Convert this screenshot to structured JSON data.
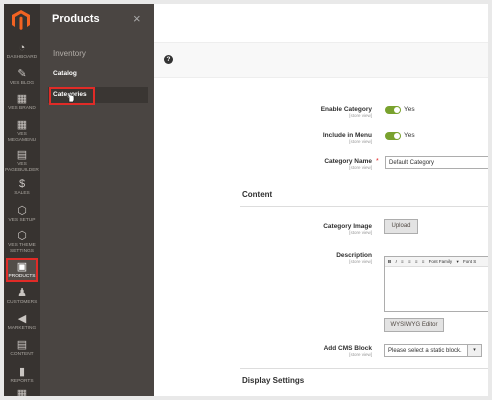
{
  "nav": {
    "items": [
      {
        "label": "DASHBOARD",
        "icon": "dashboard-icon",
        "glyph": "◔"
      },
      {
        "label": "VES BLOG",
        "icon": "pen-icon",
        "glyph": "✎"
      },
      {
        "label": "VES BRAND",
        "icon": "store-icon",
        "glyph": "▦"
      },
      {
        "label": "VES MEGAMENU",
        "icon": "grid-icon",
        "glyph": "▦"
      },
      {
        "label": "VES PAGEBUILDER",
        "icon": "page-builder-icon",
        "glyph": "▤"
      },
      {
        "label": "SALES",
        "icon": "dollar-icon",
        "glyph": "$"
      },
      {
        "label": "VES SETUP",
        "icon": "hexagon-icon",
        "glyph": "⬡"
      },
      {
        "label": "VES THEME SETTINGS",
        "icon": "hexagon-icon",
        "glyph": "⬡"
      },
      {
        "label": "PRODUCTS",
        "icon": "box-icon",
        "glyph": "▣"
      },
      {
        "label": "CUSTOMERS",
        "icon": "person-icon",
        "glyph": "♟"
      },
      {
        "label": "MARKETING",
        "icon": "megaphone-icon",
        "glyph": "◀"
      },
      {
        "label": "CONTENT",
        "icon": "content-icon",
        "glyph": "▤"
      },
      {
        "label": "REPORTS",
        "icon": "bar-chart-icon",
        "glyph": "▮"
      },
      {
        "label": "",
        "icon": "store-icon",
        "glyph": "▦"
      }
    ],
    "active_color": "#e02b27"
  },
  "flyout": {
    "title": "Products",
    "close_glyph": "×",
    "section": "Inventory",
    "links": [
      "Catalog",
      "Categories"
    ]
  },
  "main": {
    "help_glyph": "?",
    "enable_category": {
      "label": "Enable Category",
      "scope": "[store view]",
      "value": "Yes"
    },
    "include_in_menu": {
      "label": "Include in Menu",
      "scope": "[store view]",
      "value": "Yes"
    },
    "category_name": {
      "label": "Category Name",
      "scope": "[store view]",
      "value": "Default Category",
      "required": "*"
    },
    "content_heading": "Content",
    "category_image": {
      "label": "Category Image",
      "scope": "[store view]",
      "button": "Upload"
    },
    "description": {
      "label": "Description",
      "scope": "[store view]",
      "toolbar": [
        "B",
        "I",
        "≡",
        "≡",
        "≡",
        "≡",
        "Font Family",
        "▾",
        "Font S"
      ],
      "editor_button": "WYSIWYG Editor"
    },
    "cms_block": {
      "label": "Add CMS Block",
      "scope": "[store view]",
      "value": "Please select a static block.",
      "arrow": "▾"
    },
    "display_heading": "Display Settings"
  },
  "colors": {
    "accent": "#e02b27",
    "toggle_on": "#79a22e",
    "sidebar": "#373330",
    "flyout": "#4a4542"
  }
}
